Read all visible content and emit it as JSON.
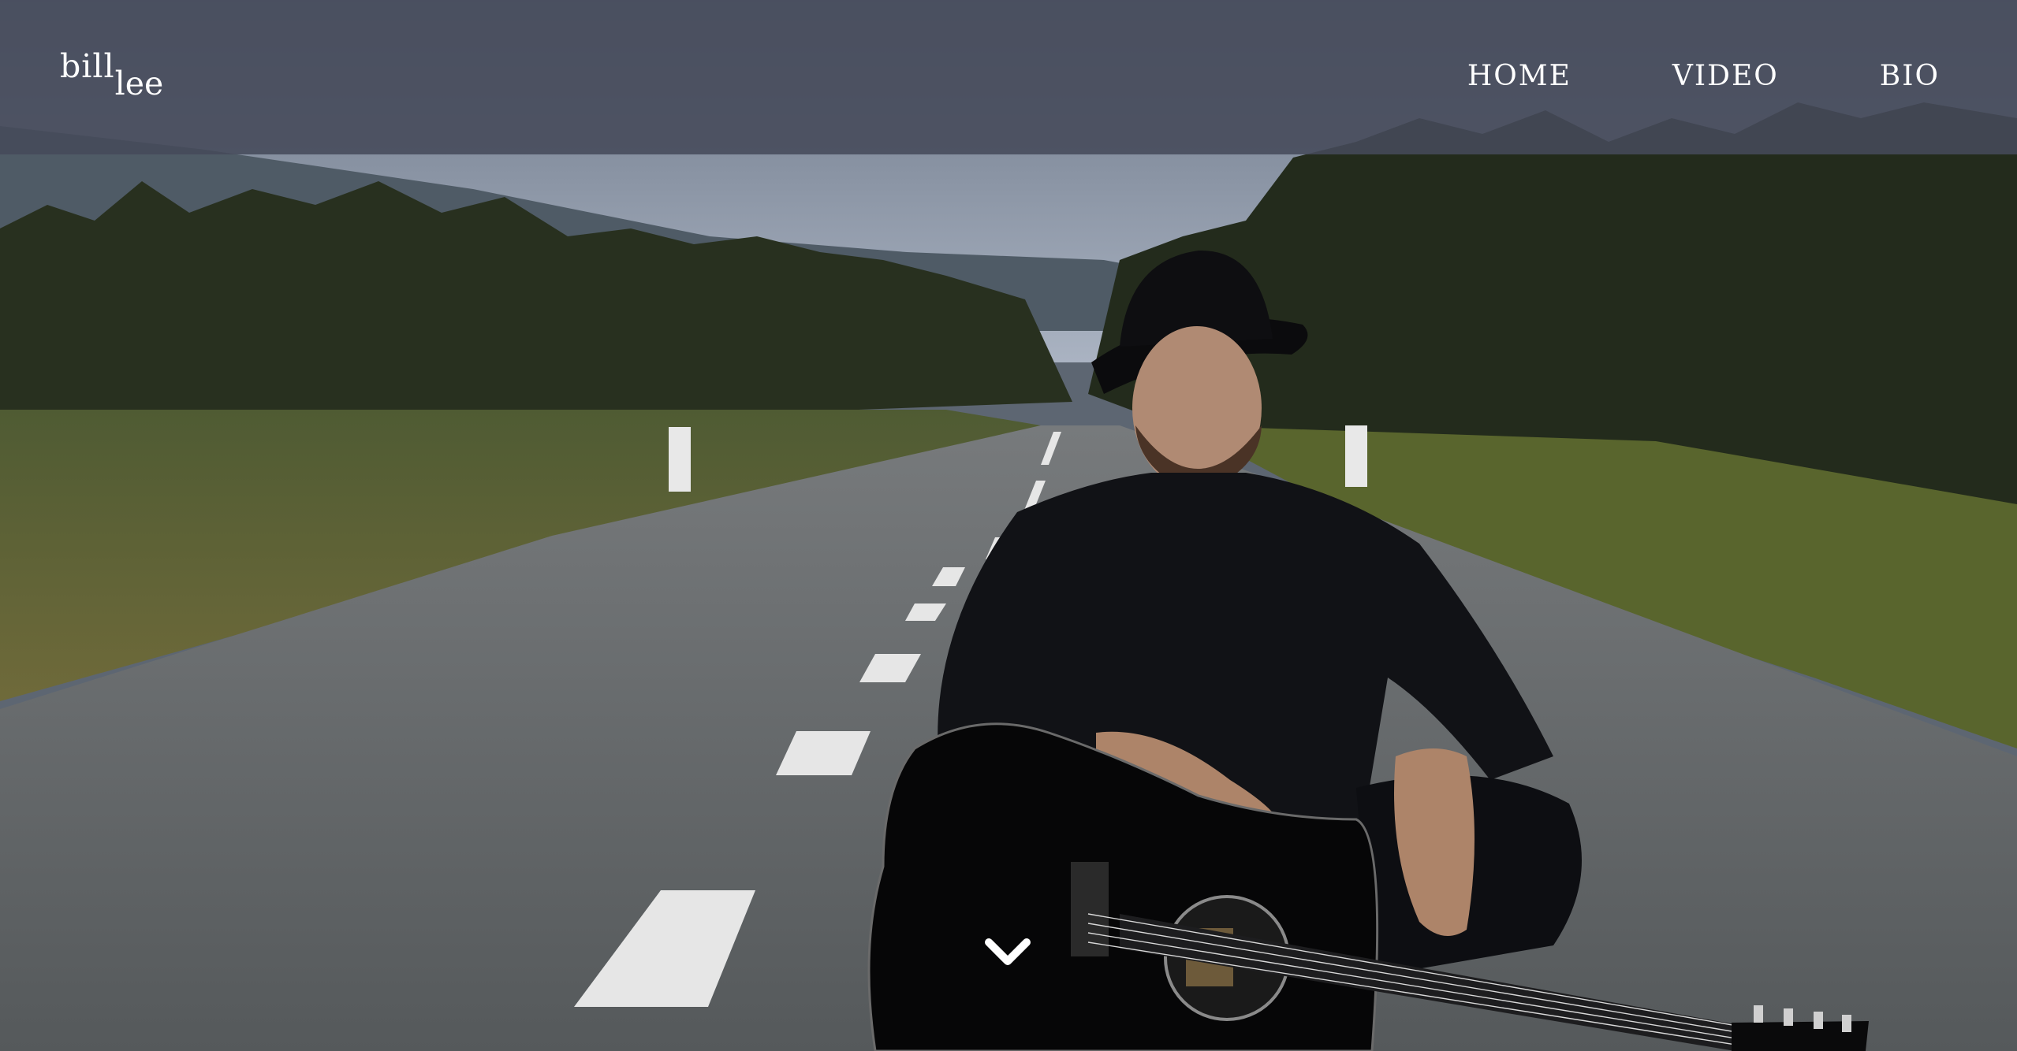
{
  "brand": {
    "first": "bill",
    "last": "lee"
  },
  "nav": {
    "items": [
      {
        "label": "HOME"
      },
      {
        "label": "VIDEO"
      },
      {
        "label": "BIO"
      }
    ]
  },
  "hero": {
    "image": "musician-with-acoustic-guitar-on-road",
    "scroll_icon": "chevron-down-icon"
  },
  "colors": {
    "header_overlay": "#464a5a",
    "text": "#ffffff"
  }
}
